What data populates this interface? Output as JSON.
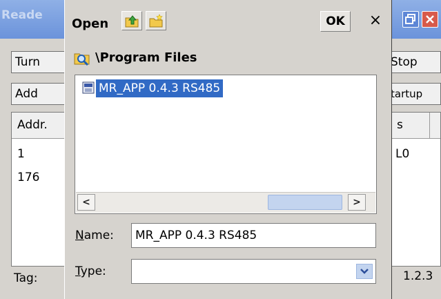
{
  "background_app": {
    "title": "Reade",
    "buttons": {
      "turn": "Turn",
      "add": "Add",
      "stop": "Stop",
      "startup": "tartup"
    },
    "grid": {
      "headers": [
        "Addr.",
        "s",
        ""
      ],
      "rows": [
        {
          "addr": "1",
          "value": "L0"
        },
        {
          "addr": "176",
          "value": ""
        }
      ]
    },
    "tag_label": "Tag:",
    "tag_value": "1.2.3"
  },
  "dialog": {
    "title": "Open",
    "ok_label": "OK",
    "close_label": "×",
    "path": "\\Program Files",
    "files": [
      {
        "name": "MR_APP 0.4.3 RS485",
        "selected": true
      }
    ],
    "name_label_first": "N",
    "name_label_rest": "ame:",
    "name_value": "MR_APP 0.4.3 RS485",
    "type_label_first": "T",
    "type_label_rest": "ype:",
    "type_value": "",
    "scroll_left": "<",
    "scroll_right": ">"
  },
  "colors": {
    "selection": "#316ac5",
    "dialog_face": "#d6d3ce"
  },
  "icons": [
    "up-folder-icon",
    "new-folder-icon",
    "folder-search-icon",
    "file-icon",
    "restore-icon",
    "close-icon",
    "dropdown-arrow-icon"
  ]
}
